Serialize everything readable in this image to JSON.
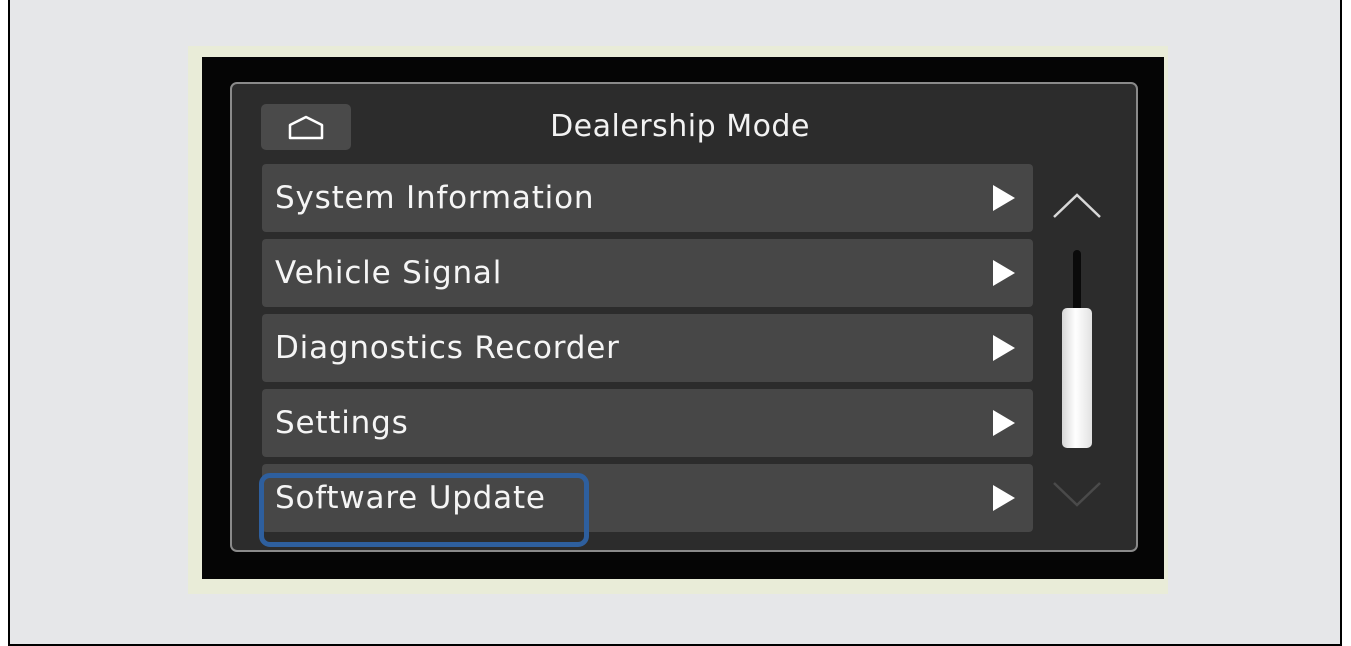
{
  "screen": {
    "title": "Dealership Mode"
  },
  "menu": {
    "items": [
      {
        "label": "System Information"
      },
      {
        "label": "Vehicle Signal"
      },
      {
        "label": "Diagnostics Recorder"
      },
      {
        "label": "Settings"
      },
      {
        "label": "Software Update",
        "highlighted": true
      }
    ]
  },
  "icons": {
    "home": "home-icon",
    "item_arrow": "chevron-right-icon",
    "scroll_up": "chevron-up-icon",
    "scroll_down": "chevron-down-icon"
  },
  "colors": {
    "highlight_outline": "#2e5f9e",
    "menu_item_bg": "#474747",
    "panel_bg": "#2c2c2c"
  }
}
